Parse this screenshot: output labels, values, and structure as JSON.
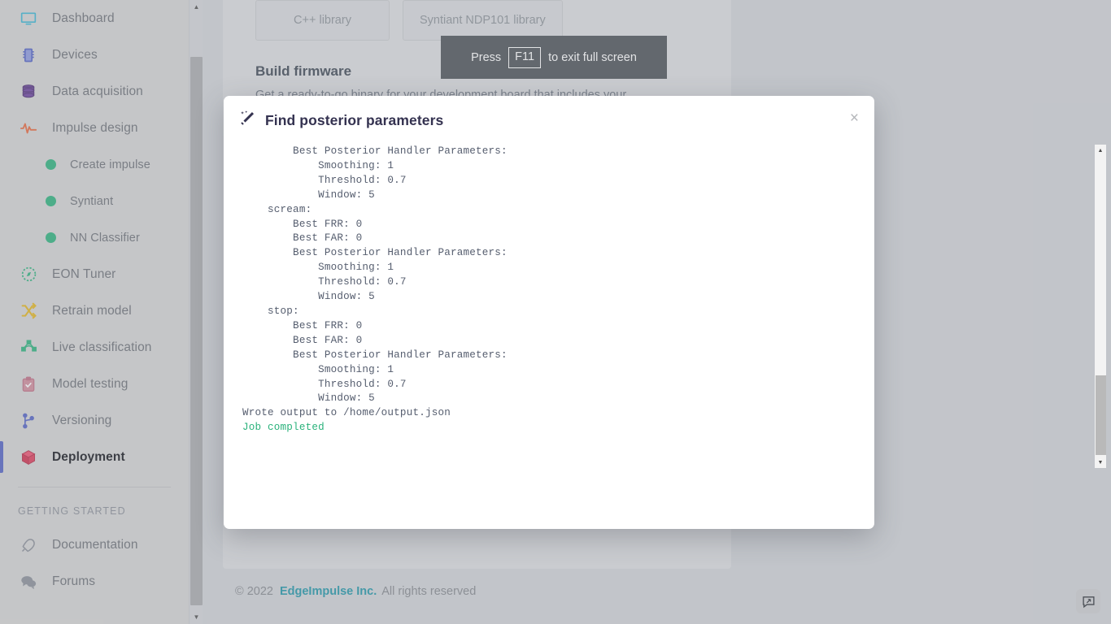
{
  "sidebar": {
    "items": [
      {
        "label": "Dashboard",
        "icon": "monitor-icon",
        "type": "item",
        "active": false
      },
      {
        "label": "Devices",
        "icon": "chip-icon",
        "type": "item",
        "active": false
      },
      {
        "label": "Data acquisition",
        "icon": "database-icon",
        "type": "item",
        "active": false
      },
      {
        "label": "Impulse design",
        "icon": "pulse-icon",
        "type": "item",
        "active": false
      },
      {
        "label": "Create impulse",
        "icon": "dot-icon",
        "type": "sub",
        "active": false
      },
      {
        "label": "Syntiant",
        "icon": "dot-icon",
        "type": "sub",
        "active": false
      },
      {
        "label": "NN Classifier",
        "icon": "dot-icon",
        "type": "sub",
        "active": false
      },
      {
        "label": "EON Tuner",
        "icon": "compass-icon",
        "type": "item",
        "active": false
      },
      {
        "label": "Retrain model",
        "icon": "shuffle-icon",
        "type": "item",
        "active": false
      },
      {
        "label": "Live classification",
        "icon": "network-icon",
        "type": "item",
        "active": false
      },
      {
        "label": "Model testing",
        "icon": "clipboard-check-icon",
        "type": "item",
        "active": false
      },
      {
        "label": "Versioning",
        "icon": "branch-icon",
        "type": "item",
        "active": false
      },
      {
        "label": "Deployment",
        "icon": "cube-icon",
        "type": "item",
        "active": true
      }
    ],
    "section_title": "GETTING STARTED",
    "footer_items": [
      {
        "label": "Documentation",
        "icon": "rocket-icon"
      },
      {
        "label": "Forums",
        "icon": "chat-icon"
      }
    ]
  },
  "main": {
    "library_tabs": [
      {
        "label": "C++ library"
      },
      {
        "label": "Syntiant NDP101 library"
      }
    ],
    "build_firmware": {
      "title": "Build firmware",
      "description_plain": "Get a ready-to-go binary for your development board that includes your"
    }
  },
  "fullscreen_toast": {
    "prefix": "Press",
    "key": "F11",
    "suffix": "to exit full screen"
  },
  "modal": {
    "title": "Find posterior parameters",
    "title_icon": "magic-wand-icon",
    "close_label": "×",
    "console_text": "        Best Posterior Handler Parameters:\n            Smoothing: 1\n            Threshold: 0.7\n            Window: 5\n    scream:\n        Best FRR: 0\n        Best FAR: 0\n        Best Posterior Handler Parameters:\n            Smoothing: 1\n            Threshold: 0.7\n            Window: 5\n    stop:\n        Best FRR: 0\n        Best FAR: 0\n        Best Posterior Handler Parameters:\n            Smoothing: 1\n            Threshold: 0.7\n            Window: 5\nWrote output to /home/output.json\n",
    "console_status": "Job completed",
    "scrollbar": {
      "up_arrow": "▲",
      "down_arrow": "▼"
    }
  },
  "footer": {
    "copyright": "© 2022",
    "brand": "EdgeImpulse Inc.",
    "rights": "All rights reserved"
  },
  "feedback": {
    "icon": "feedback-bubble-icon"
  },
  "sidebar_scrollbar": {
    "up_arrow": "▲",
    "down_arrow": "▼"
  },
  "colors": {
    "accent_brand": "#1f96a8",
    "active_indicator": "#5161c4",
    "success_green": "#2ab27b",
    "modal_title": "#343250",
    "console_text": "#555d6e"
  }
}
